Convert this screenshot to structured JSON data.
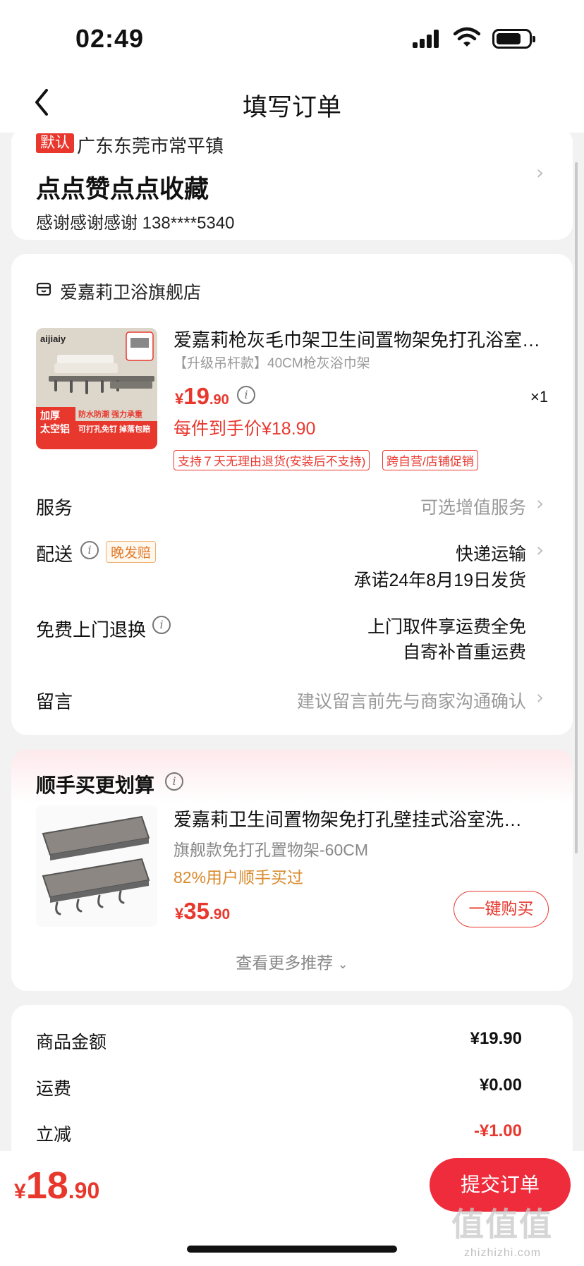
{
  "status_bar": {
    "time": "02:49"
  },
  "nav": {
    "title": "填写订单"
  },
  "address": {
    "default_tag": "默认",
    "region": "广东东莞市常平镇",
    "detail": "点点赞点点收藏",
    "contact": "感谢感谢感谢  138****5340"
  },
  "store": {
    "name": "爱嘉莉卫浴旗舰店",
    "product": {
      "title": "爱嘉莉枪灰毛巾架卫生间置物架免打孔浴室…",
      "spec": "【升级吊杆款】40CM枪灰浴巾架",
      "price_currency": "¥",
      "price_int": "19",
      "price_dec": ".90",
      "quantity": "×1",
      "final_price": "每件到手价¥18.90",
      "tags": [
        "支持７天无理由退货(安装后不支持)",
        "跨自营/店铺促销"
      ],
      "image_text": {
        "brand": "aijiaiy",
        "line1": "加厚",
        "line2": "太空铝",
        "feature": "防水防潮 强力承重",
        "bottom": "可打孔免钉 掉落包赔"
      }
    }
  },
  "rows": {
    "service": {
      "label": "服务",
      "value": "可选增值服务"
    },
    "delivery": {
      "label": "配送",
      "tag": "晚发赔",
      "value": "快递运输",
      "promise": "承诺24年8月19日发货"
    },
    "return": {
      "label": "免费上门退换",
      "line1": "上门取件享运费全免",
      "line2": "自寄补首重运费"
    },
    "message": {
      "label": "留言",
      "placeholder": "建议留言前先与商家沟通确认"
    }
  },
  "recommend": {
    "title": "顺手买更划算",
    "item": {
      "name": "爱嘉莉卫生间置物架免打孔壁挂式浴室洗…",
      "spec": "旗舰款免打孔置物架-60CM",
      "bought": "82%用户顺手买过",
      "price_currency": "¥",
      "price_int": "35",
      "price_dec": ".90",
      "buy_label": "一键购买"
    },
    "more": "查看更多推荐"
  },
  "summary": {
    "items": [
      {
        "label": "商品金额",
        "value": "¥19.90",
        "red": false
      },
      {
        "label": "运费",
        "value": "¥0.00",
        "red": false
      },
      {
        "label": "立减",
        "value": "-¥1.00",
        "red": true
      }
    ]
  },
  "bottom": {
    "total_currency": "¥",
    "total_int": "18",
    "total_dec": ".90",
    "submit_label": "提交订单"
  },
  "watermark": {
    "main": "值值值",
    "sub": "zhizhizhi.com"
  },
  "colors": {
    "accent": "#e8382e",
    "submit": "#ee2c3c",
    "orange": "#d98a2b"
  }
}
